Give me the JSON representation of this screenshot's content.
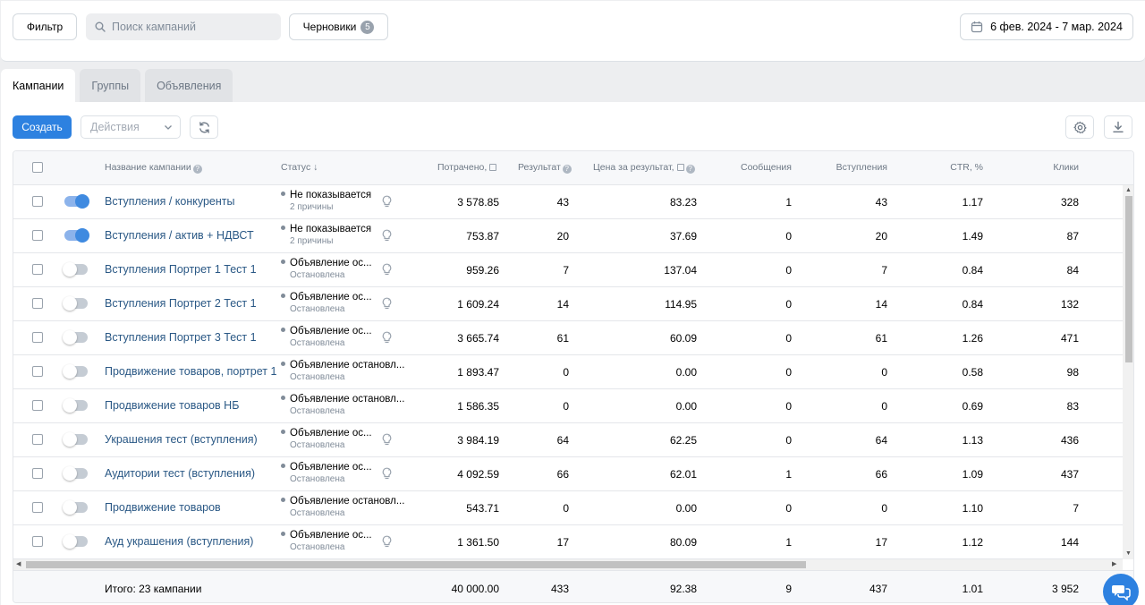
{
  "toolbar": {
    "filter_label": "Фильтр",
    "search_placeholder": "Поиск кампаний",
    "drafts_label": "Черновики",
    "drafts_count": "5",
    "date_range": "6 фев. 2024 - 7 мар. 2024"
  },
  "tabs": [
    {
      "label": "Кампании",
      "active": true
    },
    {
      "label": "Группы",
      "active": false
    },
    {
      "label": "Объявления",
      "active": false
    }
  ],
  "actions": {
    "create_label": "Создать",
    "actions_placeholder": "Действия"
  },
  "columns": {
    "name": "Название кампании",
    "status": "Статус ↓",
    "spent": "Потрачено,",
    "result": "Результат",
    "cost_per_result": "Цена за результат,",
    "messages": "Сообщения",
    "joins": "Вступления",
    "ctr": "CTR, %",
    "clicks": "Клики"
  },
  "rows": [
    {
      "name": "Вступления / конкуренты",
      "enabled": true,
      "status": "Не показывается",
      "status_sub": "2 причины",
      "hint_icon": true,
      "spent": "3 578.85",
      "result": "43",
      "cpr": "83.23",
      "messages": "1",
      "joins": "43",
      "ctr": "1.17",
      "clicks": "328"
    },
    {
      "name": "Вступления / актив + НДВСТ",
      "enabled": true,
      "status": "Не показывается",
      "status_sub": "2 причины",
      "hint_icon": true,
      "spent": "753.87",
      "result": "20",
      "cpr": "37.69",
      "messages": "0",
      "joins": "20",
      "ctr": "1.49",
      "clicks": "87"
    },
    {
      "name": "Вступления Портрет 1 Тест 1",
      "enabled": false,
      "status": "Объявление ос...",
      "status_sub": "Остановлена",
      "hint_icon": true,
      "spent": "959.26",
      "result": "7",
      "cpr": "137.04",
      "messages": "0",
      "joins": "7",
      "ctr": "0.84",
      "clicks": "84"
    },
    {
      "name": "Вступления Портрет 2 Тест 1",
      "enabled": false,
      "status": "Объявление ос...",
      "status_sub": "Остановлена",
      "hint_icon": true,
      "spent": "1 609.24",
      "result": "14",
      "cpr": "114.95",
      "messages": "0",
      "joins": "14",
      "ctr": "0.84",
      "clicks": "132"
    },
    {
      "name": "Вступления Портрет 3 Тест 1",
      "enabled": false,
      "status": "Объявление ос...",
      "status_sub": "Остановлена",
      "hint_icon": true,
      "spent": "3 665.74",
      "result": "61",
      "cpr": "60.09",
      "messages": "0",
      "joins": "61",
      "ctr": "1.26",
      "clicks": "471"
    },
    {
      "name": "Продвижение товаров, портрет 1",
      "enabled": false,
      "status": "Объявление остановл...",
      "status_sub": "Остановлена",
      "hint_icon": false,
      "spent": "1 893.47",
      "result": "0",
      "cpr": "0.00",
      "messages": "0",
      "joins": "0",
      "ctr": "0.58",
      "clicks": "98"
    },
    {
      "name": "Продвижение товаров НБ",
      "enabled": false,
      "status": "Объявление остановл...",
      "status_sub": "Остановлена",
      "hint_icon": false,
      "spent": "1 586.35",
      "result": "0",
      "cpr": "0.00",
      "messages": "0",
      "joins": "0",
      "ctr": "0.69",
      "clicks": "83"
    },
    {
      "name": "Украшения тест (вступления)",
      "enabled": false,
      "status": "Объявление ос...",
      "status_sub": "Остановлена",
      "hint_icon": true,
      "spent": "3 984.19",
      "result": "64",
      "cpr": "62.25",
      "messages": "0",
      "joins": "64",
      "ctr": "1.13",
      "clicks": "436"
    },
    {
      "name": "Аудитории тест (вступления)",
      "enabled": false,
      "status": "Объявление ос...",
      "status_sub": "Остановлена",
      "hint_icon": true,
      "spent": "4 092.59",
      "result": "66",
      "cpr": "62.01",
      "messages": "1",
      "joins": "66",
      "ctr": "1.09",
      "clicks": "437"
    },
    {
      "name": "Продвижение товаров",
      "enabled": false,
      "status": "Объявление остановл...",
      "status_sub": "Остановлена",
      "hint_icon": false,
      "spent": "543.71",
      "result": "0",
      "cpr": "0.00",
      "messages": "0",
      "joins": "0",
      "ctr": "1.10",
      "clicks": "7"
    },
    {
      "name": "Ауд украшения (вступления)",
      "enabled": false,
      "status": "Объявление ос...",
      "status_sub": "Остановлена",
      "hint_icon": true,
      "spent": "1 361.50",
      "result": "17",
      "cpr": "80.09",
      "messages": "1",
      "joins": "17",
      "ctr": "1.12",
      "clicks": "144"
    }
  ],
  "totals": {
    "label": "Итого: 23 кампании",
    "spent": "40 000.00",
    "result": "433",
    "cpr": "92.38",
    "messages": "9",
    "joins": "437",
    "ctr": "1.01",
    "clicks": "3 952"
  },
  "colors": {
    "accent": "#2d81e0",
    "link": "#2a5885",
    "toggle_on": "#3f8ae0"
  }
}
